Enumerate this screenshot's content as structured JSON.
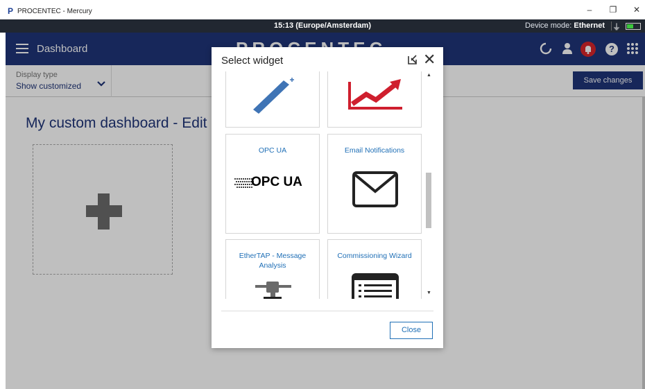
{
  "window": {
    "app_initial": "P",
    "title": "PROCENTEC - Mercury",
    "minimize": "–",
    "restore": "❐",
    "close": "✕"
  },
  "status": {
    "clock": "15:13 (Europe/Amsterdam)",
    "mode_label": "Device mode:",
    "mode_value": "Ethernet",
    "plug_icon": "plug-icon",
    "battery_icon": "battery-icon"
  },
  "header": {
    "page_title": "Dashboard",
    "brand": "PROCENTEC",
    "icons": [
      "refresh-icon",
      "user-icon",
      "bell-icon",
      "help-icon",
      "apps-grid-icon"
    ],
    "help_glyph": "?"
  },
  "toolbar": {
    "display_type_label": "Display type",
    "display_type_value": "Show customized",
    "save_label": "Save changes"
  },
  "main": {
    "edit_title": "My custom dashboard - Edit"
  },
  "modal": {
    "title": "Select widget",
    "close_label": "Close",
    "widgets": [
      {
        "label": "",
        "icon": "diagonal-tool-icon"
      },
      {
        "label": "",
        "icon": "trend-chart-icon"
      },
      {
        "label": "OPC UA",
        "icon": "opc-ua-logo"
      },
      {
        "label": "Email Notifications",
        "icon": "envelope-icon"
      },
      {
        "label": "EtherTAP - Message Analysis",
        "icon": "ethertap-icon"
      },
      {
        "label": "Commissioning Wizard",
        "icon": "wizard-list-icon"
      }
    ],
    "opc_logo_text": "OPC UA"
  },
  "colors": {
    "primary": "#1f3478",
    "link": "#1f6fb6",
    "alert": "#d9252a",
    "chart_red": "#cf1f2e",
    "tool_blue": "#3f74b5"
  }
}
